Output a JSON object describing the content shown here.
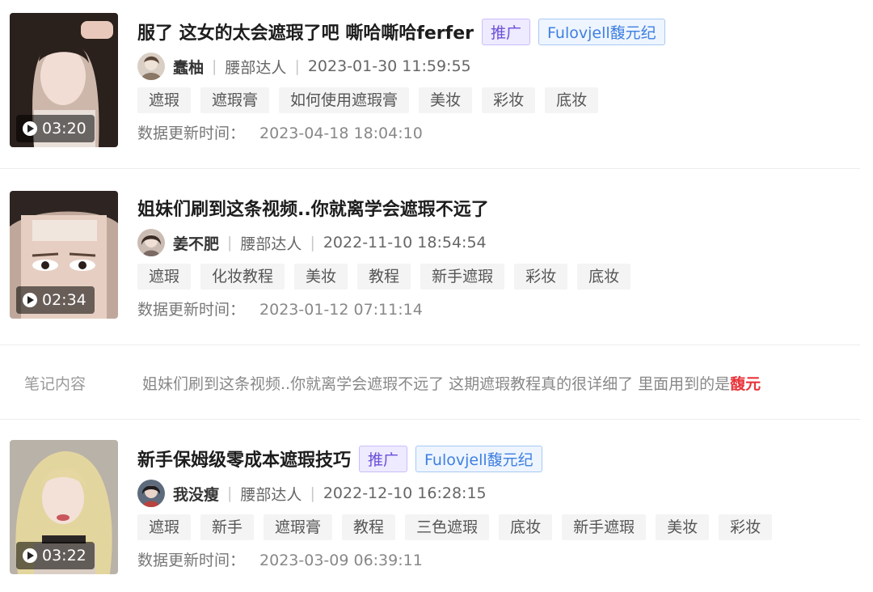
{
  "posts": [
    {
      "title": "服了 这女的太会遮瑕了吧 嘶哈嘶哈ferfer",
      "badges": [
        "推广",
        "Fulovjell馥元纪"
      ],
      "duration": "03:20",
      "author": "蠢柚",
      "category": "腰部达人",
      "published": "2023-01-30 11:59:55",
      "tags": [
        "遮瑕",
        "遮瑕膏",
        "如何使用遮瑕膏",
        "美妆",
        "彩妆",
        "底妆"
      ],
      "update_label": "数据更新时间：",
      "update_time": "2023-04-18 18:04:10"
    },
    {
      "title": "姐妹们刷到这条视频..你就离学会遮瑕不远了",
      "badges": [],
      "duration": "02:34",
      "author": "姜不肥",
      "category": "腰部达人",
      "published": "2022-11-10 18:54:54",
      "tags": [
        "遮瑕",
        "化妆教程",
        "美妆",
        "教程",
        "新手遮瑕",
        "彩妆",
        "底妆"
      ],
      "update_label": "数据更新时间：",
      "update_time": "2023-01-12 07:11:14"
    },
    {
      "title": "新手保姆级零成本遮瑕技巧",
      "badges": [
        "推广",
        "Fulovjell馥元纪"
      ],
      "duration": "03:22",
      "author": "我没瘦",
      "category": "腰部达人",
      "published": "2022-12-10 16:28:15",
      "tags": [
        "遮瑕",
        "新手",
        "遮瑕膏",
        "教程",
        "三色遮瑕",
        "底妆",
        "新手遮瑕",
        "美妆",
        "彩妆"
      ],
      "update_label": "数据更新时间：",
      "update_time": "2023-03-09 06:39:11"
    }
  ],
  "note": {
    "label": "笔记内容",
    "text": "姐妹们刷到这条视频..你就离学会遮瑕不远了 这期遮瑕教程真的很详细了 里面用到的是",
    "highlight": "馥元"
  },
  "colors": {
    "promo_badge": "#6b4fd8",
    "brand_badge": "#3f7fe0",
    "highlight": "#e8353b"
  }
}
